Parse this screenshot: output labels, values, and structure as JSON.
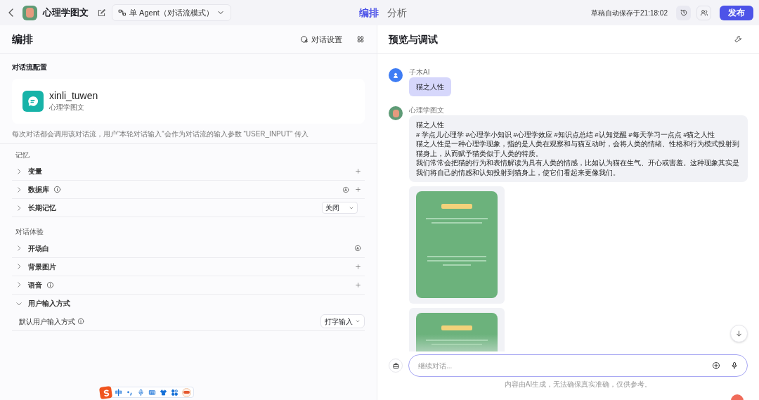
{
  "header": {
    "app_name": "心理学图文",
    "mode_selector": "单 Agent（对话流模式）",
    "tabs": [
      {
        "label": "编排",
        "selected": true
      },
      {
        "label": "分析",
        "selected": false
      }
    ],
    "autosave": "草稿自动保存于21:18:02",
    "publish": "发布"
  },
  "left_panel": {
    "title": "编排",
    "settings_button": "对话设置",
    "section_title": "对话流配置",
    "workflow": {
      "name": "xinli_tuwen",
      "description": "心理学图文"
    },
    "note": "每次对话都会调用该对话流，用户“本轮对话输入”会作为对话流的输入参数 “USER_INPUT” 传入",
    "groups": [
      {
        "title": "记忆",
        "items": [
          {
            "label": "变量",
            "expanded": false,
            "info": false,
            "actions": [
              {
                "kind": "add"
              }
            ]
          },
          {
            "label": "数据库",
            "expanded": false,
            "info": true,
            "actions": [
              {
                "kind": "auto"
              },
              {
                "kind": "add"
              }
            ]
          },
          {
            "label": "长期记忆",
            "expanded": false,
            "info": false,
            "actions": [
              {
                "kind": "select",
                "value": "关闭"
              }
            ]
          }
        ]
      },
      {
        "title": "对话体验",
        "items": [
          {
            "label": "开场白",
            "expanded": false,
            "info": false,
            "actions": [
              {
                "kind": "auto"
              }
            ]
          },
          {
            "label": "背景图片",
            "expanded": false,
            "info": false,
            "actions": [
              {
                "kind": "add"
              }
            ]
          },
          {
            "label": "语音",
            "expanded": false,
            "info": true,
            "actions": [
              {
                "kind": "add"
              }
            ]
          },
          {
            "label": "用户输入方式",
            "expanded": true,
            "info": false,
            "children": [
              {
                "label": "默认用户输入方式",
                "info": true,
                "select": "打字输入"
              }
            ]
          }
        ]
      }
    ]
  },
  "right_panel": {
    "title": "预览与调试",
    "messages": [
      {
        "kind": "user",
        "sender": "子木AI",
        "text": "猫之人性"
      },
      {
        "kind": "bot",
        "sender": "心理学图文",
        "paragraphs": [
          "猫之人性",
          "# 学点儿心理学 #心理学小知识 #心理学效应 #知识点总结 #认知觉醒 #每天学习一点点 #猫之人性",
          "猫之人性是一种心理学现象，指的是人类在观察和与猫互动时，会将人类的情绪、性格和行为模式投射到猫身上，从而赋予猫类似于人类的特质。",
          "我们常常会把猫的行为和表情解读为具有人类的情感，比如认为猫在生气、开心或害羞。这种现象其实是我们将自己的情感和认知投射到猫身上，使它们看起来更像我们。"
        ],
        "images": [
          {
            "kind": "picture",
            "faded": false
          },
          {
            "kind": "picture",
            "faded": true
          }
        ]
      }
    ],
    "input_placeholder": "继续对话...",
    "disclaimer": "内容由AI生成，无法确保真实准确，仅供参考。"
  },
  "ime_toolbar": {
    "mode": "中"
  }
}
